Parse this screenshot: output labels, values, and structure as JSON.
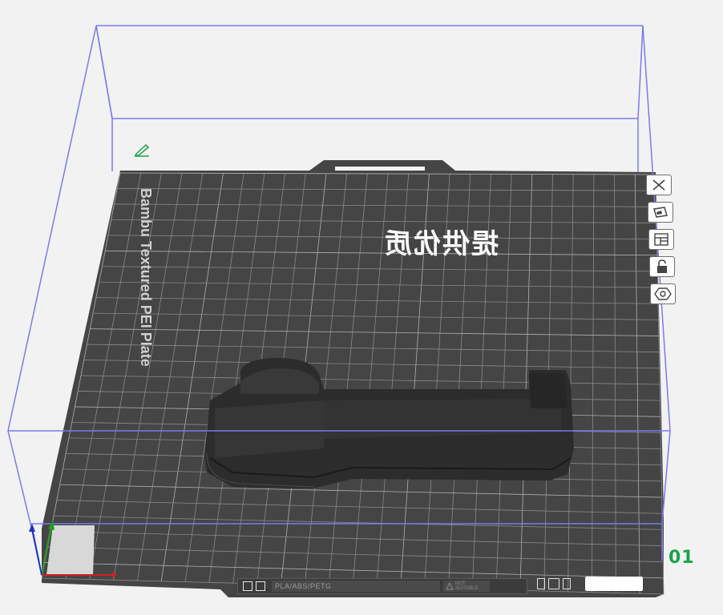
{
  "viewport": {
    "plate_type_label": "Bambu Textured PEI Plate",
    "embossed_text": "提供优质",
    "plate_number": "01",
    "colors": {
      "background": "#f2f2f2",
      "plate": "#454545",
      "plate_grid": "#8a8a8a",
      "bounding_box": "#7777ee",
      "model": "#2a2a2a",
      "accent_green": "#1aa34a",
      "axis_x": "#d02020",
      "axis_y": "#20a020",
      "axis_z": "#2030c0"
    }
  },
  "toolbar": {
    "buttons": [
      {
        "icon": "close-icon"
      },
      {
        "icon": "pick-plate-icon"
      },
      {
        "icon": "arrange-icon"
      },
      {
        "icon": "lock-icon"
      },
      {
        "icon": "settings-hexagon-icon"
      }
    ]
  },
  "status_bar": {
    "filament_types": "PLA/ABS/PETG",
    "warning_text": "NOT SUITABLE",
    "plate_name": ""
  }
}
